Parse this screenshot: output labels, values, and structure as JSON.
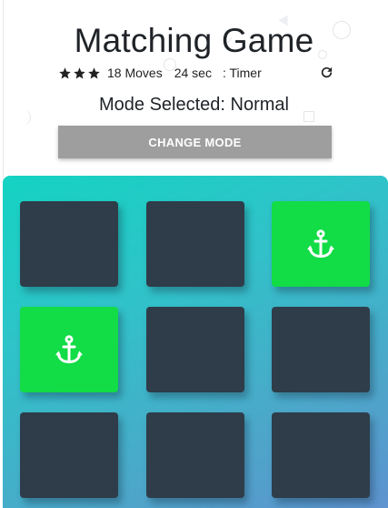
{
  "header": {
    "title": "Matching Game"
  },
  "score_panel": {
    "star_rating": 3,
    "stars": [
      "star-icon",
      "star-icon",
      "star-icon"
    ],
    "moves": "18 Moves",
    "timer_value": "24 sec",
    "timer_label": ": Timer",
    "restart_icon": "restart-icon"
  },
  "mode": {
    "label": "Mode Selected: Normal",
    "button_label": "CHANGE MODE"
  },
  "colors": {
    "card_back": "#2e3d49",
    "card_match": "#12dc46",
    "deck_gradient_start": "#14d3c2",
    "deck_gradient_end": "#5e93cf",
    "button_gray": "#9e9e9e"
  },
  "deck": {
    "cards": [
      {
        "state": "closed",
        "icon": ""
      },
      {
        "state": "closed",
        "icon": ""
      },
      {
        "state": "match",
        "icon": "anchor-icon"
      },
      {
        "state": "match",
        "icon": "anchor-icon"
      },
      {
        "state": "closed",
        "icon": ""
      },
      {
        "state": "closed",
        "icon": ""
      },
      {
        "state": "closed",
        "icon": ""
      },
      {
        "state": "closed",
        "icon": ""
      },
      {
        "state": "closed",
        "icon": ""
      }
    ]
  }
}
